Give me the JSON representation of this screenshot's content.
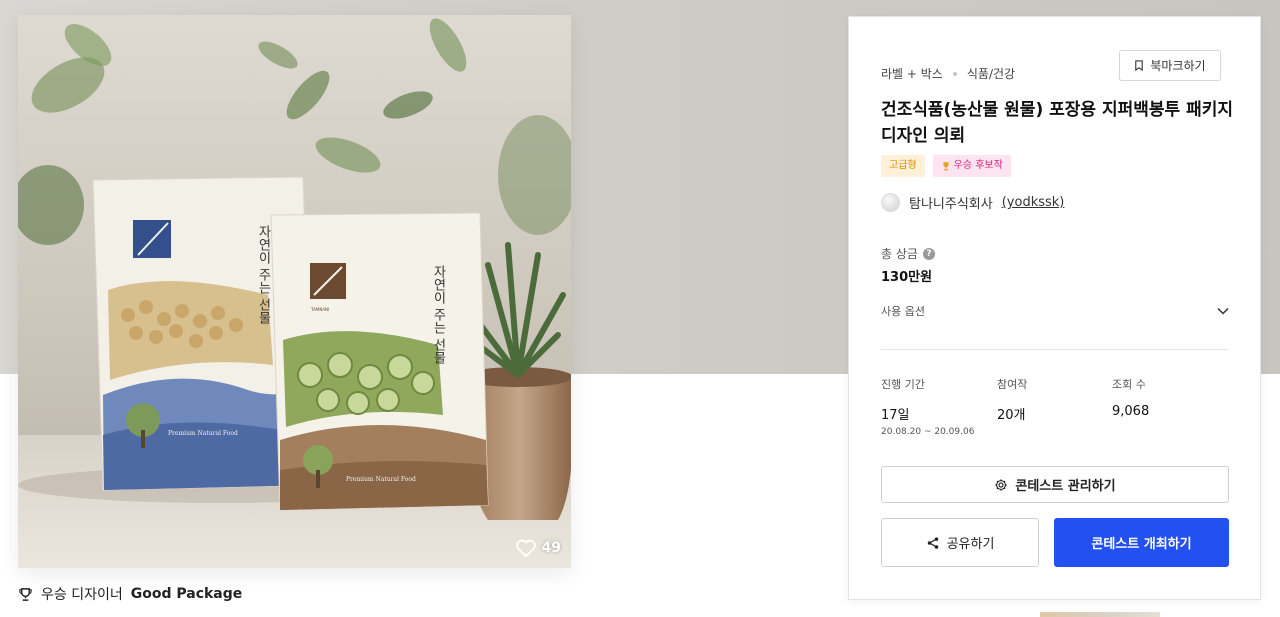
{
  "image": {
    "pouch_left_text": "자연이 주는 선물",
    "pouch_right_text": "자연이 주는 선물",
    "pouch_brand": "TAMNANI",
    "pouch_subtext": "Premium Natural Food",
    "like_count": "49"
  },
  "winner": {
    "prefix": "우승 디자이너",
    "name": "Good Package"
  },
  "panel": {
    "category_main": "라벨 + 박스",
    "category_sub": "식품/건강",
    "bookmark_label": "북마크하기",
    "title": "건조식품(농산물 원물) 포장용 지퍼백봉투 패키지 디자인 의뢰",
    "badge_grade": "고급형",
    "badge_winner": "우승 후보작",
    "owner_name": "탐나니주식회사",
    "owner_id": "(yodkssk)",
    "prize_label": "총 상금",
    "prize_value": "130만원",
    "options_label": "사용 옵션",
    "stats": {
      "period_label": "진행 기간",
      "period_value": "17일",
      "period_range": "20.08.20 ~ 20.09.06",
      "entries_label": "참여작",
      "entries_value": "20개",
      "views_label": "조회 수",
      "views_value": "9,068"
    },
    "manage_label": "콘테스트 관리하기",
    "share_label": "공유하기",
    "host_label": "콘테스트 개최하기"
  },
  "colors": {
    "accent": "#2350f0",
    "badge_grade_bg": "#fff0d8",
    "badge_winner_bg": "#fde4f0"
  }
}
